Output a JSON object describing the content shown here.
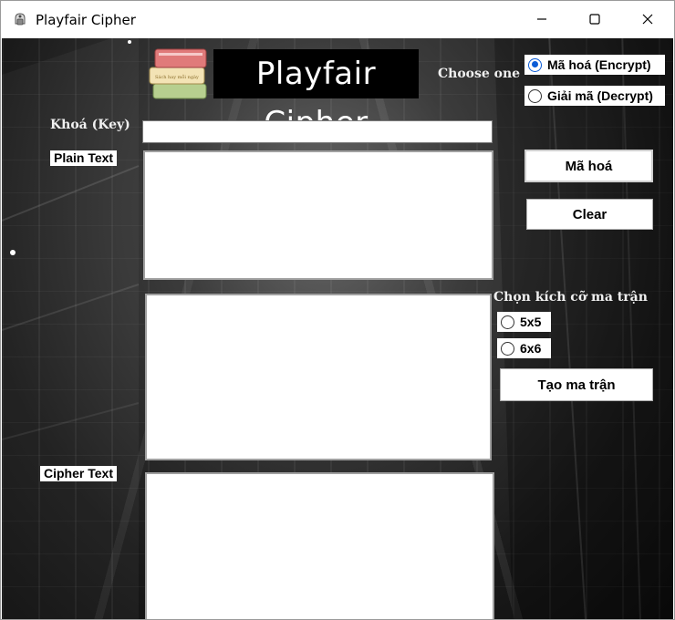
{
  "window": {
    "title": "Playfair Cipher",
    "controls": [
      "minimize-icon",
      "maximize-icon",
      "close-icon"
    ]
  },
  "header": {
    "logo_title": "Playfair Cipher",
    "book_stamp": "Sách hay mỗi ngày"
  },
  "mode": {
    "label": "Choose one",
    "options": [
      {
        "label": "Mã hoá (Encrypt)",
        "selected": true
      },
      {
        "label": "Giải mã (Decrypt)",
        "selected": false
      }
    ]
  },
  "key": {
    "label": "Khoá (Key)",
    "value": ""
  },
  "plain": {
    "label": "Plain Text",
    "value": ""
  },
  "matrix": {
    "value": ""
  },
  "cipher": {
    "label": "Cipher Text",
    "value": ""
  },
  "buttons": {
    "encrypt": "Mã hoá",
    "clear": "Clear",
    "create_matrix": "Tạo ma trận"
  },
  "matrix_size": {
    "label": "Chọn kích cỡ ma trận",
    "options": [
      {
        "label": "5x5",
        "selected": false
      },
      {
        "label": "6x6",
        "selected": false
      }
    ]
  },
  "colors": {
    "accent": "#0a5bd6",
    "background": "#1a1a1a",
    "panel": "#ffffff"
  }
}
